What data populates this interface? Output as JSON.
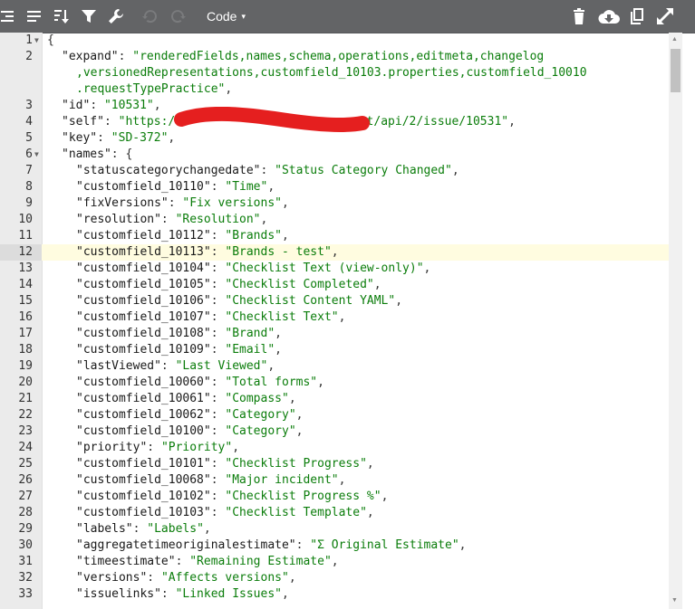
{
  "toolbar": {
    "mode_label": "Code",
    "mode_caret": "▾"
  },
  "lines": [
    {
      "n": "1",
      "fold": true,
      "parts": [
        [
          "p",
          "{"
        ]
      ]
    },
    {
      "n": "2",
      "i": 1,
      "parts": [
        [
          "k",
          "\"expand\""
        ],
        [
          "p",
          ": "
        ],
        [
          "s",
          "\"renderedFields,names,schema,operations,editmeta,changelog"
        ]
      ]
    },
    {
      "n": "",
      "i": 2,
      "parts": [
        [
          "s",
          ",versionedRepresentations,customfield_10103.properties,customfield_10010"
        ]
      ]
    },
    {
      "n": "",
      "i": 2,
      "parts": [
        [
          "s",
          ".requestTypePractice\""
        ],
        [
          "p",
          ","
        ]
      ]
    },
    {
      "n": "3",
      "i": 1,
      "parts": [
        [
          "k",
          "\"id\""
        ],
        [
          "p",
          ": "
        ],
        [
          "s",
          "\"10531\""
        ],
        [
          "p",
          ","
        ]
      ]
    },
    {
      "n": "4",
      "i": 1,
      "parts": [
        [
          "k",
          "\"self\""
        ],
        [
          "p",
          ": "
        ],
        [
          "s",
          "\"https:/                         est/api/2/issue/10531\""
        ],
        [
          "p",
          ","
        ]
      ]
    },
    {
      "n": "5",
      "i": 1,
      "parts": [
        [
          "k",
          "\"key\""
        ],
        [
          "p",
          ": "
        ],
        [
          "s",
          "\"SD-372\""
        ],
        [
          "p",
          ","
        ]
      ]
    },
    {
      "n": "6",
      "i": 1,
      "fold": true,
      "parts": [
        [
          "k",
          "\"names\""
        ],
        [
          "p",
          ": {"
        ]
      ]
    },
    {
      "n": "7",
      "i": 2,
      "parts": [
        [
          "k",
          "\"statuscategorychangedate\""
        ],
        [
          "p",
          ": "
        ],
        [
          "s",
          "\"Status Category Changed\""
        ],
        [
          "p",
          ","
        ]
      ]
    },
    {
      "n": "8",
      "i": 2,
      "parts": [
        [
          "k",
          "\"customfield_10110\""
        ],
        [
          "p",
          ": "
        ],
        [
          "s",
          "\"Time\""
        ],
        [
          "p",
          ","
        ]
      ]
    },
    {
      "n": "9",
      "i": 2,
      "parts": [
        [
          "k",
          "\"fixVersions\""
        ],
        [
          "p",
          ": "
        ],
        [
          "s",
          "\"Fix versions\""
        ],
        [
          "p",
          ","
        ]
      ]
    },
    {
      "n": "10",
      "i": 2,
      "parts": [
        [
          "k",
          "\"resolution\""
        ],
        [
          "p",
          ": "
        ],
        [
          "s",
          "\"Resolution\""
        ],
        [
          "p",
          ","
        ]
      ]
    },
    {
      "n": "11",
      "i": 2,
      "parts": [
        [
          "k",
          "\"customfield_10112\""
        ],
        [
          "p",
          ": "
        ],
        [
          "s",
          "\"Brands\""
        ],
        [
          "p",
          ","
        ]
      ]
    },
    {
      "n": "12",
      "i": 2,
      "active": true,
      "parts": [
        [
          "k",
          "\"customfield_10113\""
        ],
        [
          "p",
          ": "
        ],
        [
          "s",
          "\"Brands - test\""
        ],
        [
          "p",
          ","
        ]
      ]
    },
    {
      "n": "13",
      "i": 2,
      "parts": [
        [
          "k",
          "\"customfield_10104\""
        ],
        [
          "p",
          ": "
        ],
        [
          "s",
          "\"Checklist Text (view-only)\""
        ],
        [
          "p",
          ","
        ]
      ]
    },
    {
      "n": "14",
      "i": 2,
      "parts": [
        [
          "k",
          "\"customfield_10105\""
        ],
        [
          "p",
          ": "
        ],
        [
          "s",
          "\"Checklist Completed\""
        ],
        [
          "p",
          ","
        ]
      ]
    },
    {
      "n": "15",
      "i": 2,
      "parts": [
        [
          "k",
          "\"customfield_10106\""
        ],
        [
          "p",
          ": "
        ],
        [
          "s",
          "\"Checklist Content YAML\""
        ],
        [
          "p",
          ","
        ]
      ]
    },
    {
      "n": "16",
      "i": 2,
      "parts": [
        [
          "k",
          "\"customfield_10107\""
        ],
        [
          "p",
          ": "
        ],
        [
          "s",
          "\"Checklist Text\""
        ],
        [
          "p",
          ","
        ]
      ]
    },
    {
      "n": "17",
      "i": 2,
      "parts": [
        [
          "k",
          "\"customfield_10108\""
        ],
        [
          "p",
          ": "
        ],
        [
          "s",
          "\"Brand\""
        ],
        [
          "p",
          ","
        ]
      ]
    },
    {
      "n": "18",
      "i": 2,
      "parts": [
        [
          "k",
          "\"customfield_10109\""
        ],
        [
          "p",
          ": "
        ],
        [
          "s",
          "\"Email\""
        ],
        [
          "p",
          ","
        ]
      ]
    },
    {
      "n": "19",
      "i": 2,
      "parts": [
        [
          "k",
          "\"lastViewed\""
        ],
        [
          "p",
          ": "
        ],
        [
          "s",
          "\"Last Viewed\""
        ],
        [
          "p",
          ","
        ]
      ]
    },
    {
      "n": "20",
      "i": 2,
      "parts": [
        [
          "k",
          "\"customfield_10060\""
        ],
        [
          "p",
          ": "
        ],
        [
          "s",
          "\"Total forms\""
        ],
        [
          "p",
          ","
        ]
      ]
    },
    {
      "n": "21",
      "i": 2,
      "parts": [
        [
          "k",
          "\"customfield_10061\""
        ],
        [
          "p",
          ": "
        ],
        [
          "s",
          "\"Compass\""
        ],
        [
          "p",
          ","
        ]
      ]
    },
    {
      "n": "22",
      "i": 2,
      "parts": [
        [
          "k",
          "\"customfield_10062\""
        ],
        [
          "p",
          ": "
        ],
        [
          "s",
          "\"Category\""
        ],
        [
          "p",
          ","
        ]
      ]
    },
    {
      "n": "23",
      "i": 2,
      "parts": [
        [
          "k",
          "\"customfield_10100\""
        ],
        [
          "p",
          ": "
        ],
        [
          "s",
          "\"Category\""
        ],
        [
          "p",
          ","
        ]
      ]
    },
    {
      "n": "24",
      "i": 2,
      "parts": [
        [
          "k",
          "\"priority\""
        ],
        [
          "p",
          ": "
        ],
        [
          "s",
          "\"Priority\""
        ],
        [
          "p",
          ","
        ]
      ]
    },
    {
      "n": "25",
      "i": 2,
      "parts": [
        [
          "k",
          "\"customfield_10101\""
        ],
        [
          "p",
          ": "
        ],
        [
          "s",
          "\"Checklist Progress\""
        ],
        [
          "p",
          ","
        ]
      ]
    },
    {
      "n": "26",
      "i": 2,
      "parts": [
        [
          "k",
          "\"customfield_10068\""
        ],
        [
          "p",
          ": "
        ],
        [
          "s",
          "\"Major incident\""
        ],
        [
          "p",
          ","
        ]
      ]
    },
    {
      "n": "27",
      "i": 2,
      "parts": [
        [
          "k",
          "\"customfield_10102\""
        ],
        [
          "p",
          ": "
        ],
        [
          "s",
          "\"Checklist Progress %\""
        ],
        [
          "p",
          ","
        ]
      ]
    },
    {
      "n": "28",
      "i": 2,
      "parts": [
        [
          "k",
          "\"customfield_10103\""
        ],
        [
          "p",
          ": "
        ],
        [
          "s",
          "\"Checklist Template\""
        ],
        [
          "p",
          ","
        ]
      ]
    },
    {
      "n": "29",
      "i": 2,
      "parts": [
        [
          "k",
          "\"labels\""
        ],
        [
          "p",
          ": "
        ],
        [
          "s",
          "\"Labels\""
        ],
        [
          "p",
          ","
        ]
      ]
    },
    {
      "n": "30",
      "i": 2,
      "parts": [
        [
          "k",
          "\"aggregatetimeoriginalestimate\""
        ],
        [
          "p",
          ": "
        ],
        [
          "s",
          "\"Σ Original Estimate\""
        ],
        [
          "p",
          ","
        ]
      ]
    },
    {
      "n": "31",
      "i": 2,
      "parts": [
        [
          "k",
          "\"timeestimate\""
        ],
        [
          "p",
          ": "
        ],
        [
          "s",
          "\"Remaining Estimate\""
        ],
        [
          "p",
          ","
        ]
      ]
    },
    {
      "n": "32",
      "i": 2,
      "parts": [
        [
          "k",
          "\"versions\""
        ],
        [
          "p",
          ": "
        ],
        [
          "s",
          "\"Affects versions\""
        ],
        [
          "p",
          ","
        ]
      ]
    },
    {
      "n": "33",
      "i": 2,
      "parts": [
        [
          "k",
          "\"issuelinks\""
        ],
        [
          "p",
          ": "
        ],
        [
          "s",
          "\"Linked Issues\""
        ],
        [
          "p",
          ","
        ]
      ]
    }
  ]
}
